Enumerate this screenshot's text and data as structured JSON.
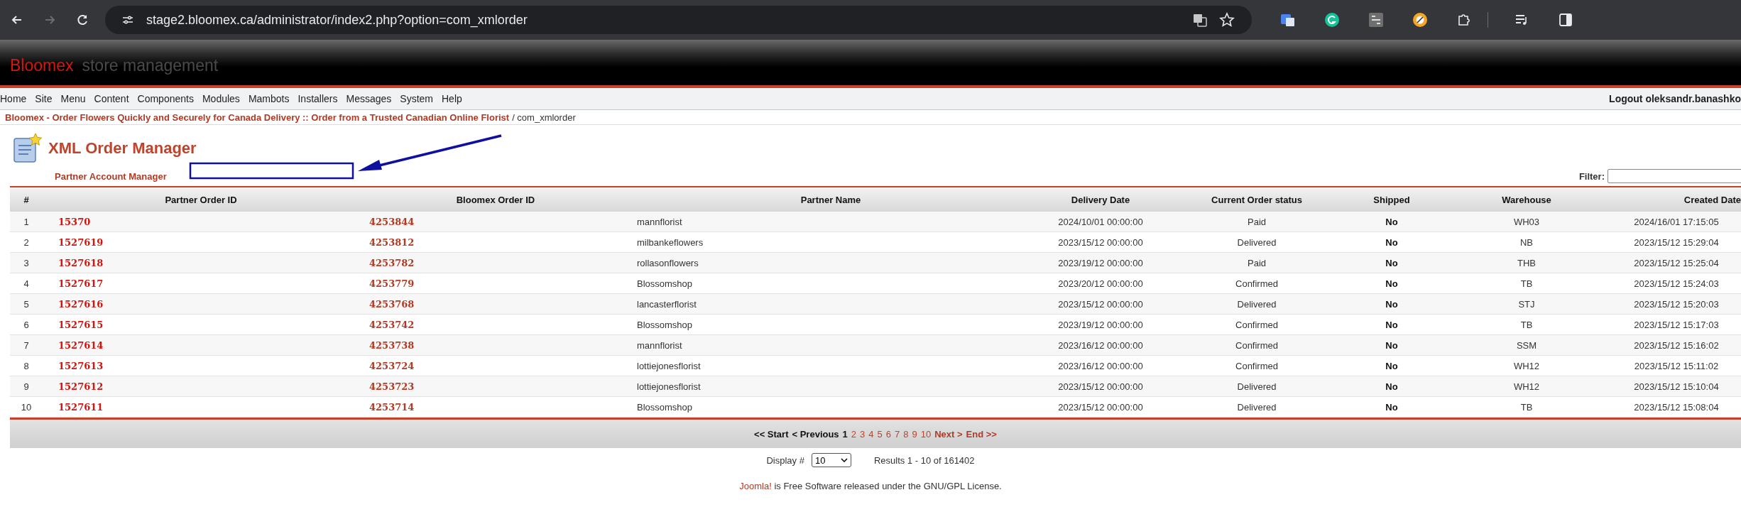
{
  "browser": {
    "url": "stage2.bloomex.ca/administrator/index2.php?option=com_xmlorder",
    "forward_disabled": true
  },
  "header": {
    "brand": "Bloomex",
    "subtitle": "store management"
  },
  "menu": {
    "items": [
      "Home",
      "Site",
      "Menu",
      "Content",
      "Components",
      "Modules",
      "Mambots",
      "Installers",
      "Messages",
      "System",
      "Help"
    ],
    "logout": "Logout oleksandr.banashko"
  },
  "breadcrumb": {
    "link": "Bloomex - Order Flowers Quickly and Securely for Canada Delivery :: Order from a Trusted Canadian Online Florist",
    "current": "/ com_xmlorder"
  },
  "page": {
    "title": "XML Order Manager",
    "partner_label": "Partner Account Manager",
    "filter_label": "Filter:"
  },
  "table": {
    "columns": [
      "#",
      "Partner Order ID",
      "Bloomex Order ID",
      "Partner Name",
      "Delivery Date",
      "Current Order status",
      "Shipped",
      "Warehouse",
      "Created Date"
    ],
    "rows": [
      [
        "1",
        "15370",
        "4253844",
        "mannflorist",
        "2024/10/01 00:00:00",
        "Paid",
        "No",
        "WH03",
        "2024/16/01 17:15:05"
      ],
      [
        "2",
        "1527619",
        "4253812",
        "milbankeflowers",
        "2023/15/12 00:00:00",
        "Delivered",
        "No",
        "NB",
        "2023/15/12 15:29:04"
      ],
      [
        "3",
        "1527618",
        "4253782",
        "rollasonflowers",
        "2023/19/12 00:00:00",
        "Paid",
        "No",
        "THB",
        "2023/15/12 15:25:04"
      ],
      [
        "4",
        "1527617",
        "4253779",
        "Blossomshop",
        "2023/20/12 00:00:00",
        "Confirmed",
        "No",
        "TB",
        "2023/15/12 15:24:03"
      ],
      [
        "5",
        "1527616",
        "4253768",
        "lancasterflorist",
        "2023/15/12 00:00:00",
        "Delivered",
        "No",
        "STJ",
        "2023/15/12 15:20:03"
      ],
      [
        "6",
        "1527615",
        "4253742",
        "Blossomshop",
        "2023/19/12 00:00:00",
        "Confirmed",
        "No",
        "TB",
        "2023/15/12 15:17:03"
      ],
      [
        "7",
        "1527614",
        "4253738",
        "mannflorist",
        "2023/16/12 00:00:00",
        "Confirmed",
        "No",
        "SSM",
        "2023/15/12 15:16:02"
      ],
      [
        "8",
        "1527613",
        "4253724",
        "lottiejonesflorist",
        "2023/16/12 00:00:00",
        "Confirmed",
        "No",
        "WH12",
        "2023/15/12 15:11:02"
      ],
      [
        "9",
        "1527612",
        "4253723",
        "lottiejonesflorist",
        "2023/15/12 00:00:00",
        "Delivered",
        "No",
        "WH12",
        "2023/15/12 15:10:04"
      ],
      [
        "10",
        "1527611",
        "4253714",
        "Blossomshop",
        "2023/15/12 00:00:00",
        "Delivered",
        "No",
        "TB",
        "2023/15/12 15:08:04"
      ]
    ]
  },
  "pagination": {
    "prev": [
      {
        "label": "<< Start",
        "disabled": true
      },
      {
        "label": "< Previous",
        "disabled": true
      }
    ],
    "pages": [
      {
        "label": "1",
        "selected": true
      },
      {
        "label": "2",
        "selected": false
      },
      {
        "label": "3",
        "selected": false
      },
      {
        "label": "4",
        "selected": false
      },
      {
        "label": "5",
        "selected": false
      },
      {
        "label": "6",
        "selected": false
      },
      {
        "label": "7",
        "selected": false
      },
      {
        "label": "8",
        "selected": false
      },
      {
        "label": "9",
        "selected": false
      },
      {
        "label": "10",
        "selected": false
      }
    ],
    "next": [
      {
        "label": "Next >",
        "disabled": false
      },
      {
        "label": "End >>",
        "disabled": false
      }
    ]
  },
  "display": {
    "label": "Display #",
    "value": "10",
    "results": "Results 1 - 10 of 161402"
  },
  "footer": {
    "link": "Joomla!",
    "text": "is Free Software released under the GNU/GPL License."
  }
}
